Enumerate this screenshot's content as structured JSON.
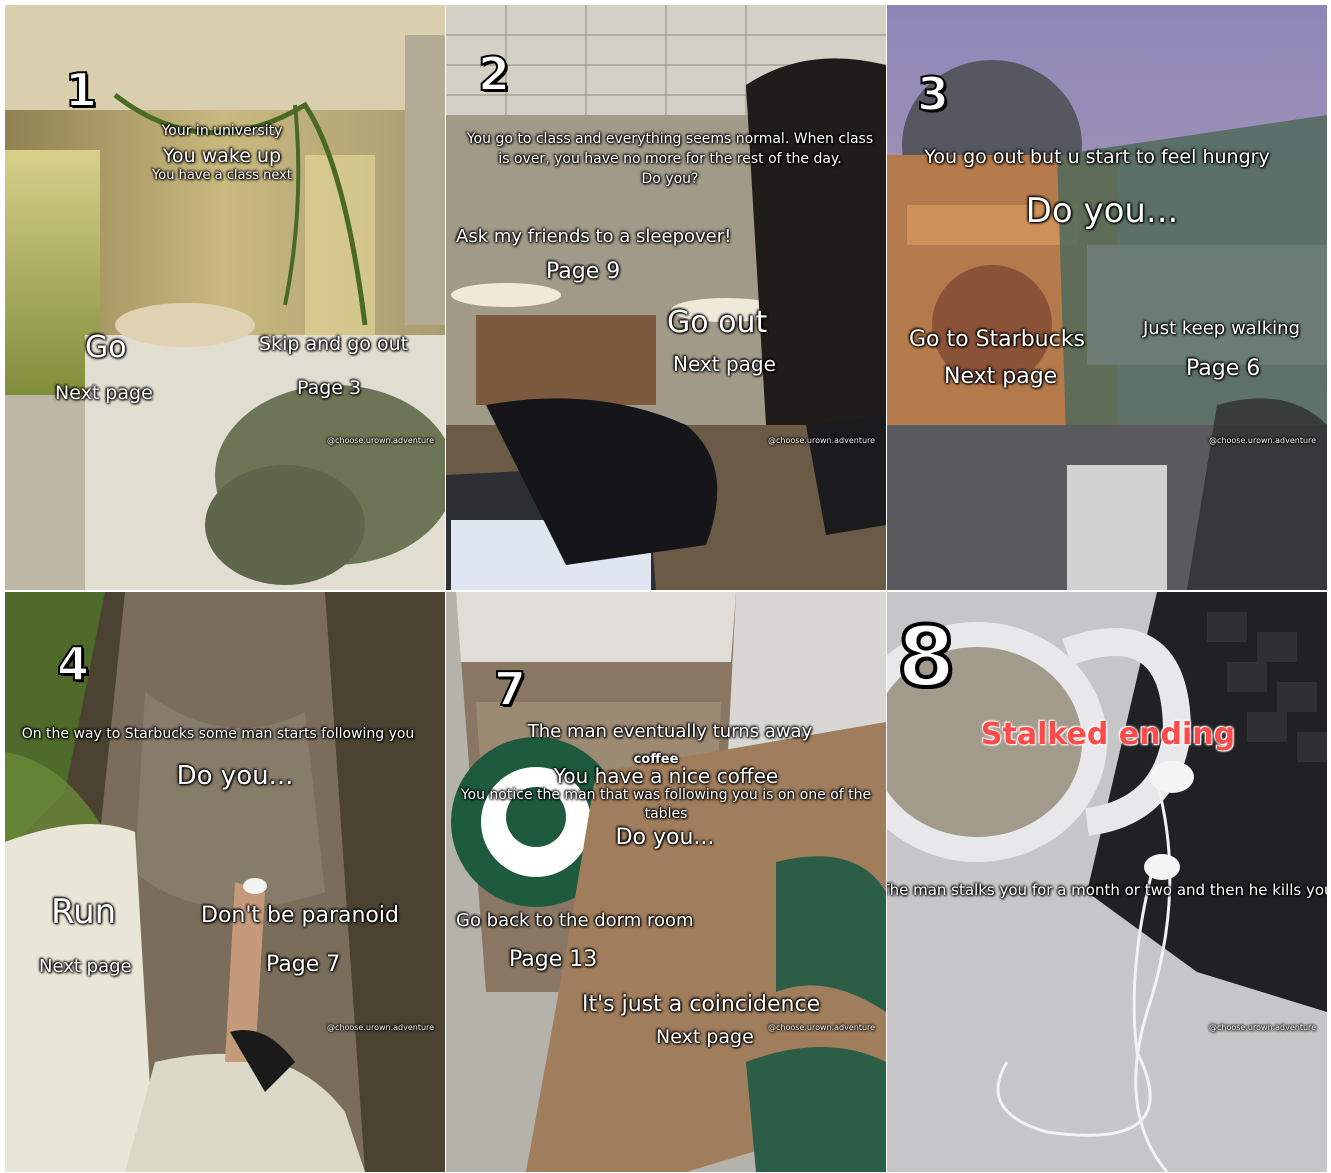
{
  "watermark": "@choose.urown.adventure",
  "panels": {
    "p1": {
      "number": "1",
      "line1": "Your in university",
      "line2": "You wake up",
      "line3": "You have a class next",
      "choice_a": "Go",
      "choice_a_page": "Next page",
      "choice_b": "Skip and go out",
      "choice_b_page": "Page 3"
    },
    "p2": {
      "number": "2",
      "story_line1": "You go to class and everything seems normal. When class",
      "story_line2": "is over, you have no more for the rest of the day.",
      "story_line3": "Do you?",
      "choice_a": "Ask my friends to a sleepover!",
      "choice_a_page": "Page 9",
      "choice_b": "Go out",
      "choice_b_page": "Next page"
    },
    "p3": {
      "number": "3",
      "story": "You go out but u start to feel hungry",
      "prompt": "Do you...",
      "choice_a": "Go to Starbucks",
      "choice_a_page": "Next page",
      "choice_b": "Just keep walking",
      "choice_b_page": "Page 6"
    },
    "p4": {
      "number": "4",
      "story": "On the way to Starbucks some man starts following you",
      "prompt": "Do you...",
      "choice_a": "Run",
      "choice_a_page": "Next page",
      "choice_b": "Don't be paranoid",
      "choice_b_page": "Page 7"
    },
    "p5": {
      "number": "7",
      "story": "The man eventually turns away",
      "small": "coffee",
      "line2": "You have a nice coffee",
      "line3a": "You notice the man that was following you is on one of the",
      "line3b": "tables",
      "prompt": "Do you...",
      "choice_a": "Go back to the dorm room",
      "choice_a_page": "Page 13",
      "choice_b": "It's just a coincidence",
      "choice_b_page": "Next page"
    },
    "p6": {
      "number": "8",
      "ending": "Stalked ending",
      "story": "The man stalks you for a month or two and then he kills you"
    }
  }
}
